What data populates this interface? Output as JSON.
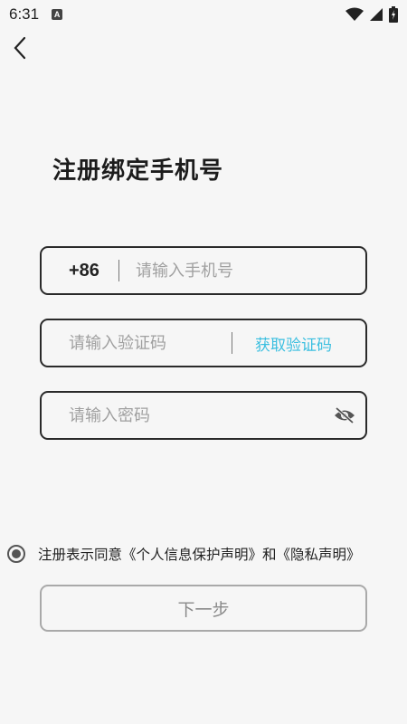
{
  "status_bar": {
    "time": "6:31",
    "notification_badge": "A",
    "icons": [
      "wifi-icon",
      "signal-icon",
      "battery-icon"
    ]
  },
  "header": {
    "back_icon": "chevron-left-icon"
  },
  "title": "注册绑定手机号",
  "phone_field": {
    "country_code": "+86",
    "placeholder": "请输入手机号",
    "value": ""
  },
  "code_field": {
    "placeholder": "请输入验证码",
    "value": "",
    "get_code_label": "获取验证码"
  },
  "password_field": {
    "placeholder": "请输入密码",
    "value": "",
    "visibility_icon": "eye-off-icon"
  },
  "agreement": {
    "text": "注册表示同意《个人信息保护声明》和《隐私声明》"
  },
  "next_button": {
    "label": "下一步"
  },
  "colors": {
    "accent": "#3bbfe0",
    "border": "#2a2a2a",
    "disabled": "#a9a9a9",
    "background": "#f6f6f6"
  }
}
